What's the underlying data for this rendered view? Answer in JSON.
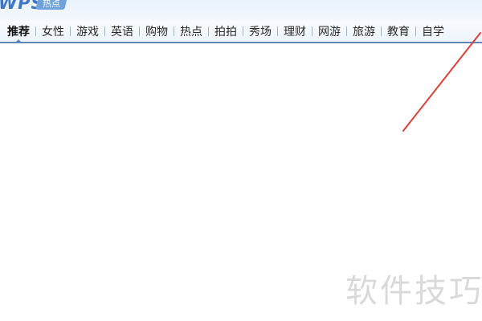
{
  "brand": {
    "logo_text": "WPS",
    "tag_text": "热点"
  },
  "nav": {
    "active_index": 0,
    "items": [
      {
        "label": "推荐"
      },
      {
        "label": "女性"
      },
      {
        "label": "游戏"
      },
      {
        "label": "英语"
      },
      {
        "label": "购物"
      },
      {
        "label": "热点"
      },
      {
        "label": "拍拍"
      },
      {
        "label": "秀场"
      },
      {
        "label": "理财"
      },
      {
        "label": "网游"
      },
      {
        "label": "旅游"
      },
      {
        "label": "教育"
      },
      {
        "label": "自学"
      }
    ]
  },
  "annotation": {
    "arrow_color": "#d9403a"
  },
  "watermark": {
    "text": "软件技巧"
  },
  "colors": {
    "accent": "#5d87b9",
    "logo_blue": "#3f77c4"
  }
}
